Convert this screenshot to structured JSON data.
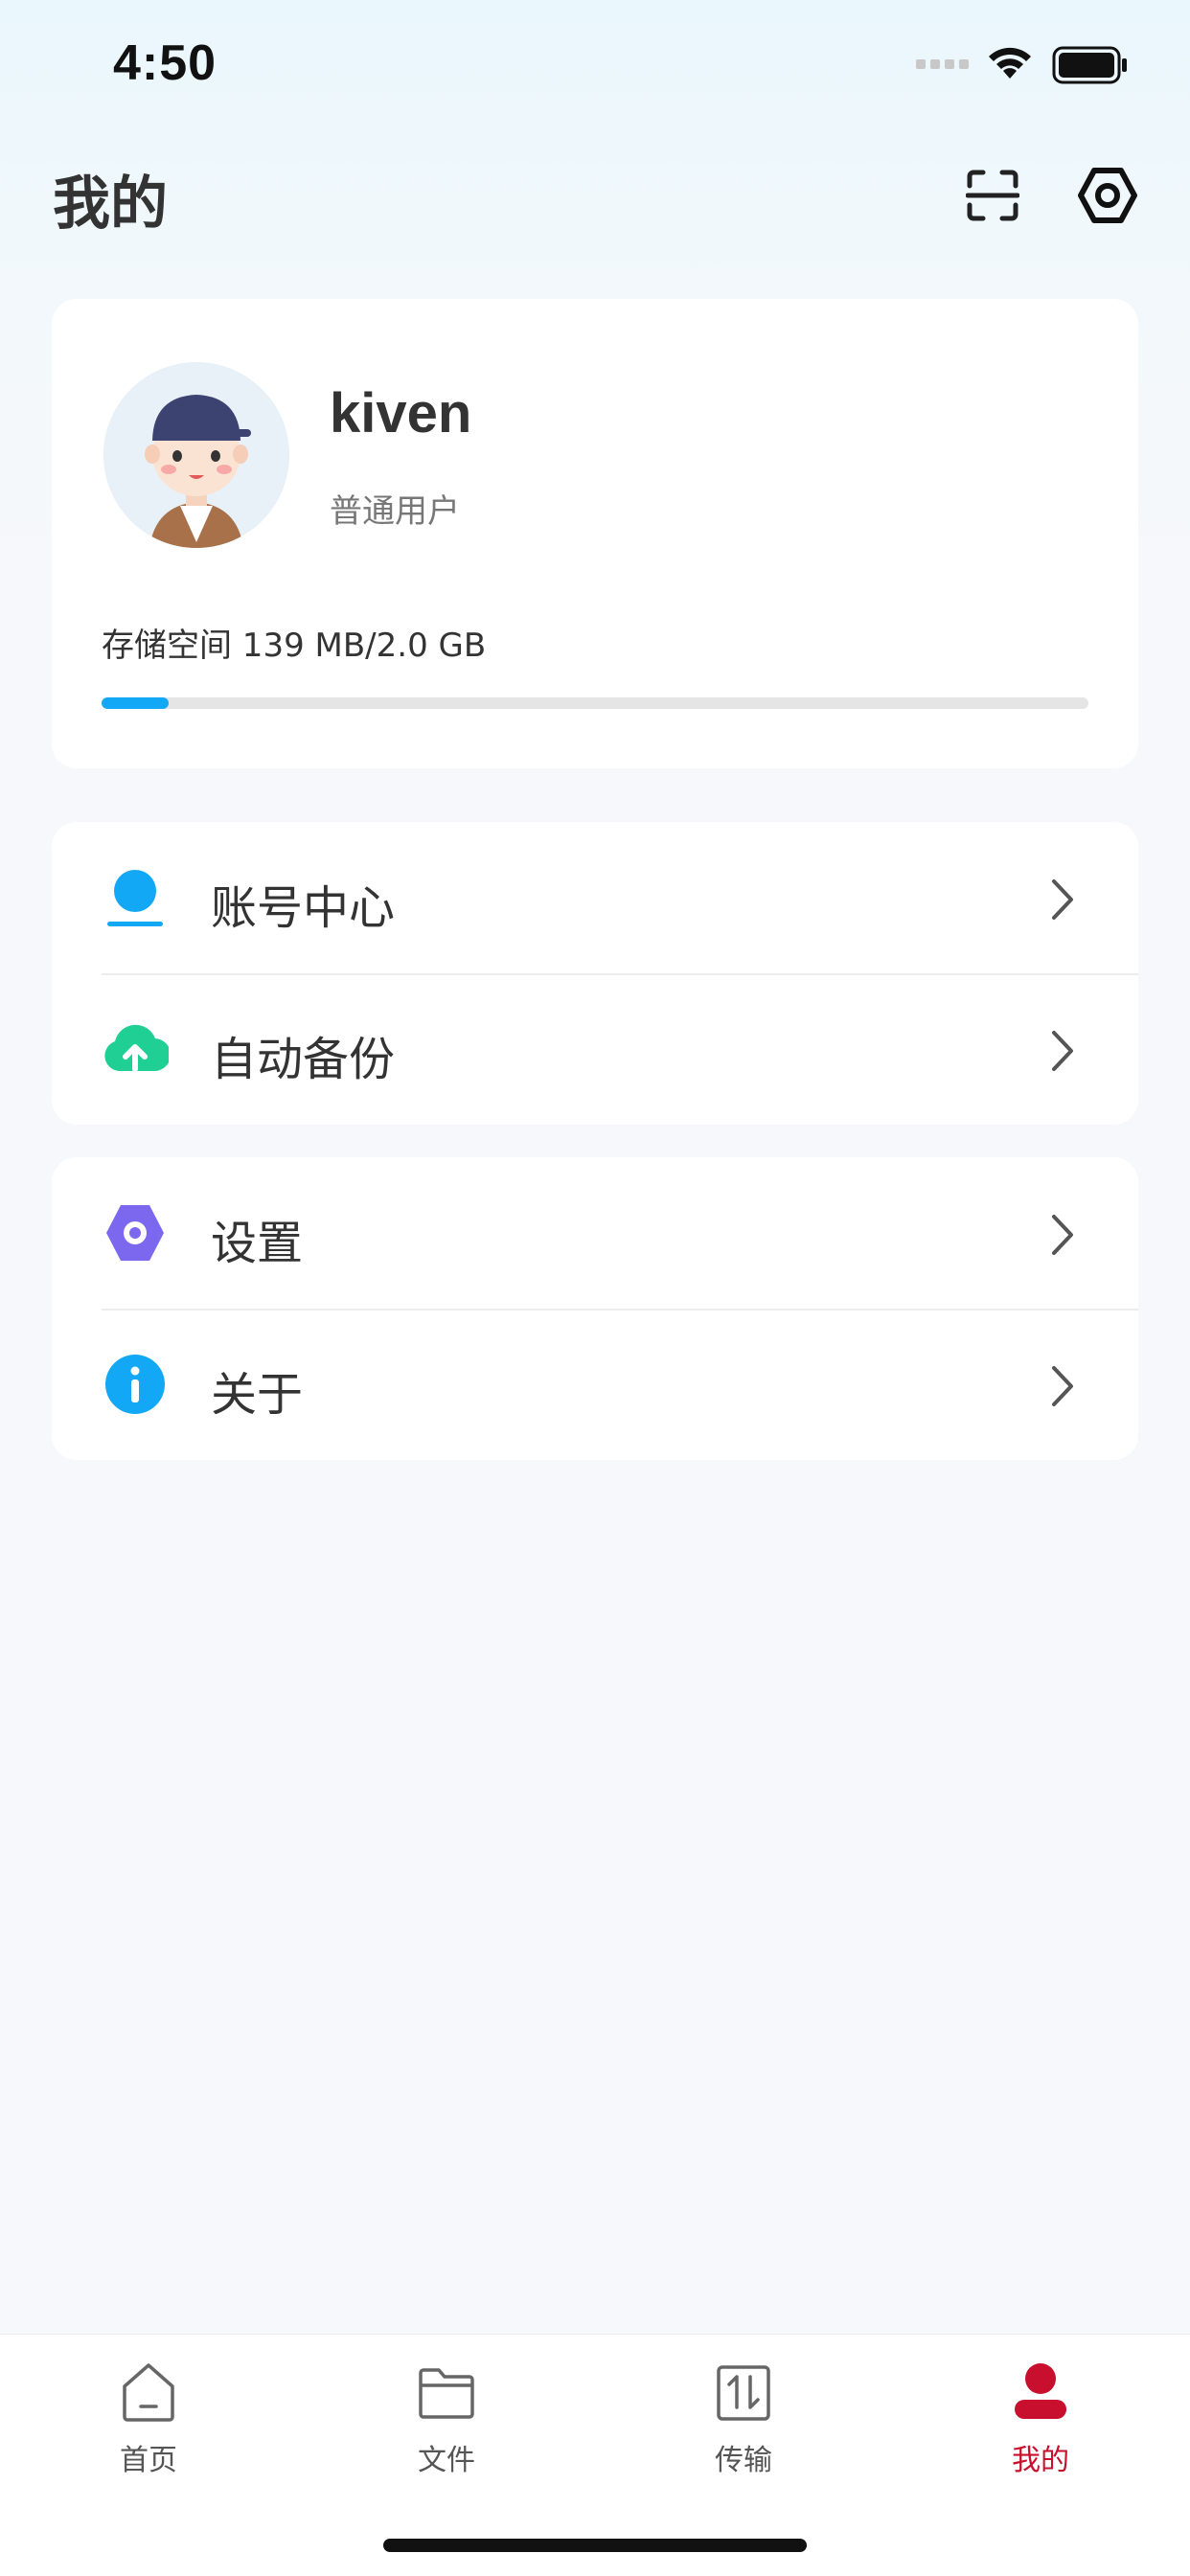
{
  "status_bar": {
    "time": "4:50"
  },
  "header": {
    "title": "我的",
    "scan_icon": "scan-icon",
    "settings_icon": "settings-hex-icon"
  },
  "profile": {
    "username": "kiven",
    "role": "普通用户",
    "storage_text": "存储空间 139 MB/2.0 GB",
    "storage_used_fraction": 0.068
  },
  "menu": {
    "group1": [
      {
        "label": "账号中心",
        "icon": "account-icon",
        "icon_color": "#13a8f5"
      },
      {
        "label": "自动备份",
        "icon": "cloud-upload-icon",
        "icon_color": "#1fcf93"
      }
    ],
    "group2": [
      {
        "label": "设置",
        "icon": "settings-icon",
        "icon_color": "#7b68ee"
      },
      {
        "label": "关于",
        "icon": "info-icon",
        "icon_color": "#13a8f5"
      }
    ]
  },
  "bottom_nav": {
    "items": [
      {
        "label": "首页",
        "icon": "home-icon",
        "active": false
      },
      {
        "label": "文件",
        "icon": "folder-icon",
        "active": false
      },
      {
        "label": "传输",
        "icon": "transfer-icon",
        "active": false
      },
      {
        "label": "我的",
        "icon": "user-icon",
        "active": true
      }
    ],
    "active_color": "#c8102e"
  }
}
